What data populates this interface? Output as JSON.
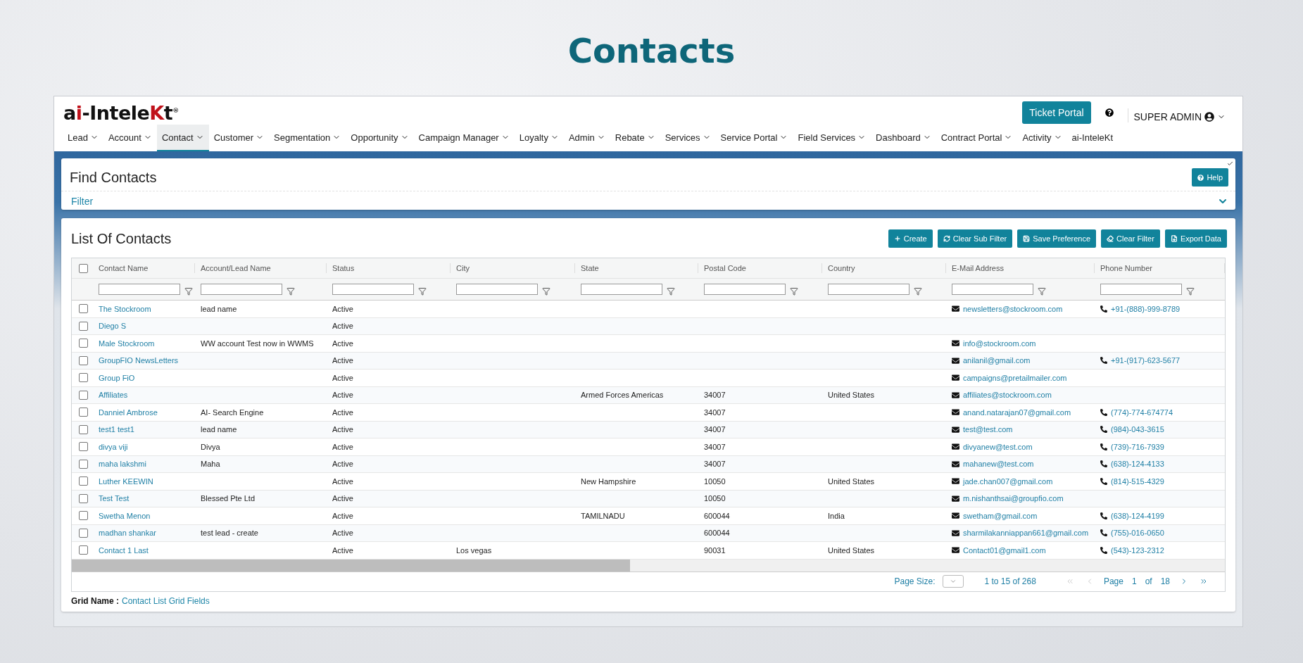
{
  "page_title": "Contacts",
  "header": {
    "logo": [
      {
        "text": "a",
        "accent": false
      },
      {
        "text": "i",
        "accent": true
      },
      {
        "text": "-Intele",
        "accent": false
      },
      {
        "text": "K",
        "accent": true
      },
      {
        "text": "t",
        "accent": false
      }
    ],
    "logo_mark": "®",
    "ticket_button": "Ticket Portal",
    "user": "SUPER ADMIN",
    "nav": [
      {
        "label": "Lead",
        "selected": false,
        "menu": true
      },
      {
        "label": "Account",
        "selected": false,
        "menu": true
      },
      {
        "label": "Contact",
        "selected": true,
        "menu": true
      },
      {
        "label": "Customer",
        "selected": false,
        "menu": true
      },
      {
        "label": "Segmentation",
        "selected": false,
        "menu": true
      },
      {
        "label": "Opportunity",
        "selected": false,
        "menu": true
      },
      {
        "label": "Campaign Manager",
        "selected": false,
        "menu": true
      },
      {
        "label": "Loyalty",
        "selected": false,
        "menu": true
      },
      {
        "label": "Admin",
        "selected": false,
        "menu": true
      },
      {
        "label": "Rebate",
        "selected": false,
        "menu": true
      },
      {
        "label": "Services",
        "selected": false,
        "menu": true
      },
      {
        "label": "Service Portal",
        "selected": false,
        "menu": true
      },
      {
        "label": "Field Services",
        "selected": false,
        "menu": true
      },
      {
        "label": "Dashboard",
        "selected": false,
        "menu": true
      },
      {
        "label": "Contract Portal",
        "selected": false,
        "menu": true
      },
      {
        "label": "Activity",
        "selected": false,
        "menu": true
      },
      {
        "label": "ai-InteleKt",
        "selected": false,
        "menu": false
      }
    ]
  },
  "find": {
    "title": "Find Contacts",
    "help": "Help",
    "filter": "Filter",
    "expanded": false
  },
  "list": {
    "title": "List Of Contacts",
    "actions": [
      {
        "kind": "create",
        "label": "Create"
      },
      {
        "kind": "refresh",
        "label": "Clear Sub Filter"
      },
      {
        "kind": "save",
        "label": "Save Preference"
      },
      {
        "kind": "erase",
        "label": "Clear Filter"
      },
      {
        "kind": "export",
        "label": "Export Data"
      }
    ],
    "all_checked": false,
    "columns": [
      "Contact Name",
      "Account/Lead Name",
      "Status",
      "City",
      "State",
      "Postal Code",
      "Country",
      "E-Mail Address",
      "Phone Number"
    ],
    "rows": [
      {
        "checked": false,
        "cells": [
          "The Stockroom",
          "lead name",
          "Active",
          "",
          "",
          "",
          "",
          "newsletters@stockroom.com",
          "+91-(888)-999-8789"
        ]
      },
      {
        "checked": false,
        "cells": [
          "Diego S",
          "",
          "Active",
          "",
          "",
          "",
          "",
          "",
          ""
        ]
      },
      {
        "checked": false,
        "cells": [
          "Male Stockroom",
          "WW account Test now in WWMS",
          "Active",
          "",
          "",
          "",
          "",
          "info@stockroom.com",
          ""
        ]
      },
      {
        "checked": false,
        "cells": [
          "GroupFIO NewsLetters",
          "",
          "Active",
          "",
          "",
          "",
          "",
          "anilanil@gmail.com",
          "+91-(917)-623-5677"
        ]
      },
      {
        "checked": false,
        "cells": [
          "Group FiO",
          "",
          "Active",
          "",
          "",
          "",
          "",
          "campaigns@pretailmailer.com",
          ""
        ]
      },
      {
        "checked": false,
        "cells": [
          "Affiliates",
          "",
          "Active",
          "",
          "Armed Forces Americas",
          "34007",
          "United States",
          "affiliates@stockroom.com",
          ""
        ]
      },
      {
        "checked": false,
        "cells": [
          "Danniel Ambrose",
          "AI- Search Engine",
          "Active",
          "",
          "",
          "34007",
          "",
          "anand.natarajan07@gmail.com",
          "(774)-774-674774"
        ]
      },
      {
        "checked": false,
        "cells": [
          "test1 test1",
          "lead name",
          "Active",
          "",
          "",
          "34007",
          "",
          "test@test.com",
          "(984)-043-3615"
        ]
      },
      {
        "checked": false,
        "cells": [
          "divya viji",
          "Divya",
          "Active",
          "",
          "",
          "34007",
          "",
          "divyanew@test.com",
          "(739)-716-7939"
        ]
      },
      {
        "checked": false,
        "cells": [
          "maha lakshmi",
          "Maha",
          "Active",
          "",
          "",
          "34007",
          "",
          "mahanew@test.com",
          "(638)-124-4133"
        ]
      },
      {
        "checked": false,
        "cells": [
          "Luther KEEWIN",
          "",
          "Active",
          "",
          "New Hampshire",
          "10050",
          "United States",
          "jade.chan007@gmail.com",
          "(814)-515-4329"
        ]
      },
      {
        "checked": false,
        "cells": [
          "Test Test",
          "Blessed Pte Ltd",
          "Active",
          "",
          "",
          "10050",
          "",
          "m.nishanthsai@groupfio.com",
          ""
        ]
      },
      {
        "checked": false,
        "cells": [
          "Swetha Menon",
          "",
          "Active",
          "",
          "TAMILNADU",
          "600044",
          "India",
          "swetham@gmail.com",
          "(638)-124-4199"
        ]
      },
      {
        "checked": false,
        "cells": [
          "madhan shankar",
          "test lead - create",
          "Active",
          "",
          "",
          "600044",
          "",
          "sharmilakanniappan661@gmail.com",
          "(755)-016-0650"
        ]
      },
      {
        "checked": false,
        "cells": [
          "Contact 1 Last",
          "",
          "Active",
          "Los vegas",
          "",
          "90031",
          "United States",
          "Contact01@gmail1.com",
          "(543)-123-2312"
        ]
      }
    ],
    "pager": {
      "size_label": "Page Size:",
      "range": "1 to 15 of 268",
      "page_label": "Page",
      "page": "1",
      "of_label": "of",
      "pages": "18",
      "first_disabled": true,
      "prev_disabled": true,
      "next_disabled": false,
      "last_disabled": false
    },
    "grid_name_label": "Grid Name :",
    "grid_name": "Contact List Grid Fields"
  }
}
